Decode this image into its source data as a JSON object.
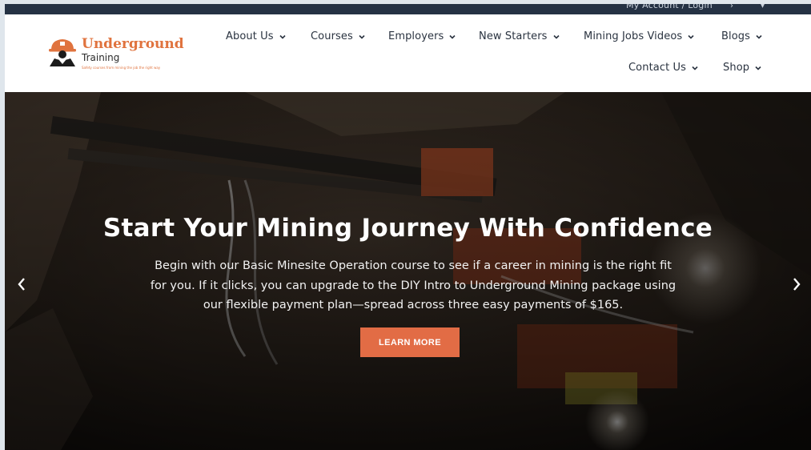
{
  "topbar": {
    "account_text": "My Account / Login"
  },
  "logo": {
    "title": "Underground",
    "subtitle": "Training",
    "tagline": "Safety courses from mining the job the right way"
  },
  "nav": {
    "row1": [
      "About Us",
      "Courses",
      "Employers",
      "New Starters",
      "Mining Jobs Videos",
      "Blogs"
    ],
    "row2": [
      "Contact Us",
      "Shop"
    ]
  },
  "hero": {
    "title": "Start Your Mining Journey With Confidence",
    "description_lines": [
      "Begin with our Basic Minesite Operation course to see if a career in mining is the right fit",
      "for you. If it clicks, you can upgrade to the DIY Intro to Underground Mining package using",
      "our flexible payment plan—spread across three easy payments of $165."
    ],
    "cta_label": "LEARN MORE"
  },
  "colors": {
    "brand_orange": "#e0733e",
    "cta": "#e26c45",
    "topbar": "#253244",
    "nav_text": "#2a3340"
  },
  "icons": [
    "user-icon",
    "cart-icon",
    "chevron-down-icon",
    "chevron-left-icon",
    "chevron-right-icon",
    "hard-hat-miner-icon"
  ]
}
